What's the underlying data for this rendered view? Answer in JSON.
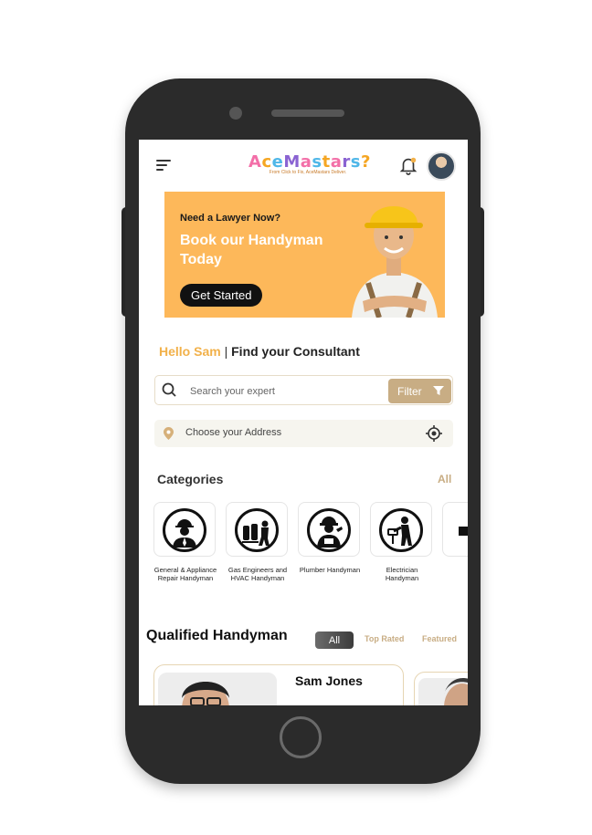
{
  "header": {
    "logo_text": "AceMastars",
    "logo_tagline": "From Click to Fix, AceMastars Deliver."
  },
  "banner": {
    "subtitle": "Need a Lawyer Now?",
    "headline": "Book our Handyman Today",
    "cta_label": "Get Started"
  },
  "greeting": {
    "hello": "Hello Sam",
    "separator": "|",
    "title": "Find your Consultant"
  },
  "search": {
    "placeholder": "Search your expert",
    "filter_label": "Filter"
  },
  "address": {
    "label": "Choose your Address"
  },
  "categories": {
    "title": "Categories",
    "all_label": "All",
    "items": [
      {
        "label": "General & Appliance Repair Handyman",
        "icon": "handyman-helmet-icon"
      },
      {
        "label": "Gas Engineers and HVAC Handyman",
        "icon": "gas-engineer-icon"
      },
      {
        "label": "Plumber Handyman",
        "icon": "plumber-icon"
      },
      {
        "label": "Electrician Handyman",
        "icon": "electrician-icon"
      }
    ]
  },
  "qualified": {
    "title": "Qualified Handyman",
    "tabs": [
      "All",
      "Top Rated",
      "Featured"
    ],
    "cards": [
      {
        "name": "Sam Jones"
      }
    ]
  },
  "colors": {
    "accent_gold": "#c8ad84",
    "banner_orange": "#fdb85a",
    "greeting_orange": "#f2b14a",
    "phone_body": "#2b2b2b"
  }
}
